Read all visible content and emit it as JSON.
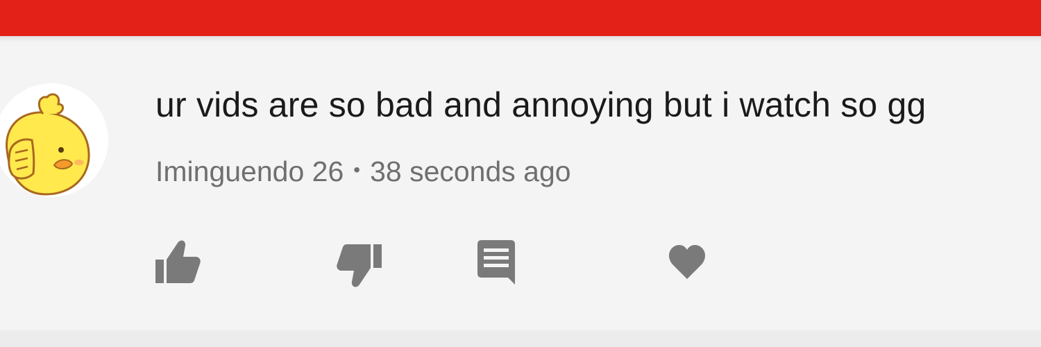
{
  "comment": {
    "text": "ur vids are so bad and annoying but i watch so gg",
    "author": "Iminguendo 26",
    "separator": "•",
    "timestamp": "38 seconds ago",
    "avatar_icon": "cartoon-duck-avatar"
  },
  "actions": {
    "like_icon": "thumbs-up-icon",
    "dislike_icon": "thumbs-down-icon",
    "reply_icon": "comment-icon",
    "heart_icon": "heart-icon"
  },
  "colors": {
    "header": "#e32119",
    "background": "#f4f4f4",
    "text": "#1a1a1a",
    "meta_text": "#6f6f6f",
    "icon": "#7a7a7a",
    "avatar_yellow": "#ffe94d"
  }
}
